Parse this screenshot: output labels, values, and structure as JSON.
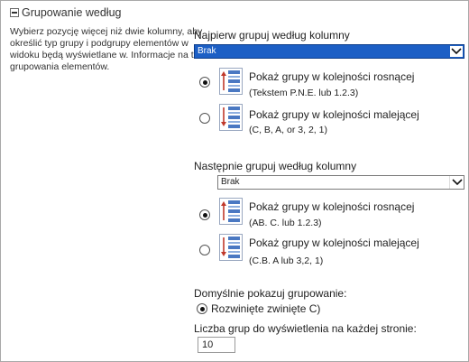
{
  "section": {
    "title": "Grupowanie według",
    "description": "Wybierz pozycję więcej niż dwie kolumny, aby określić typ grupy i podgrupy elementów w widoku będą wyświetlane w. Informacje na temat grupowania elementów."
  },
  "first_group": {
    "label": "Najpierw grupuj według kolumny",
    "select_value": "Brak",
    "options": [
      {
        "text": "Pokaż grupy w kolejności rosnącej",
        "sub": "(Tekstem P.N.E. lub 1.2.3)",
        "selected": true
      },
      {
        "text": "Pokaż grupy w kolejności malejącej",
        "sub": "(C, B, A, or 3, 2, 1)",
        "selected": false
      }
    ]
  },
  "second_group": {
    "label": "Następnie grupuj według kolumny",
    "select_value": "Brak",
    "options": [
      {
        "text": "Pokaż grupy w kolejności rosnącej",
        "sub": "(AB. C. lub 1.2.3)",
        "selected": true
      },
      {
        "text": "Pokaż grupy w kolejności malejącej",
        "sub": "(C.B. A lub 3,2, 1)",
        "selected": false
      }
    ]
  },
  "default_display": {
    "label": "Domyślnie pokazuj grupowanie:",
    "option": "Rozwinięte zwinięte C)"
  },
  "groups_per_page": {
    "label": "Liczba grup do wyświetlenia na każdej stronie:",
    "value": "10"
  },
  "icons": [
    "collapse-toggle-icon",
    "sort-ascending-icon",
    "sort-descending-icon",
    "dropdown-arrow-icon"
  ],
  "colors": {
    "select_highlight": "#1c5fc5",
    "sort_arrow": "#c0392b",
    "sort_bars": "#4a78c2"
  }
}
